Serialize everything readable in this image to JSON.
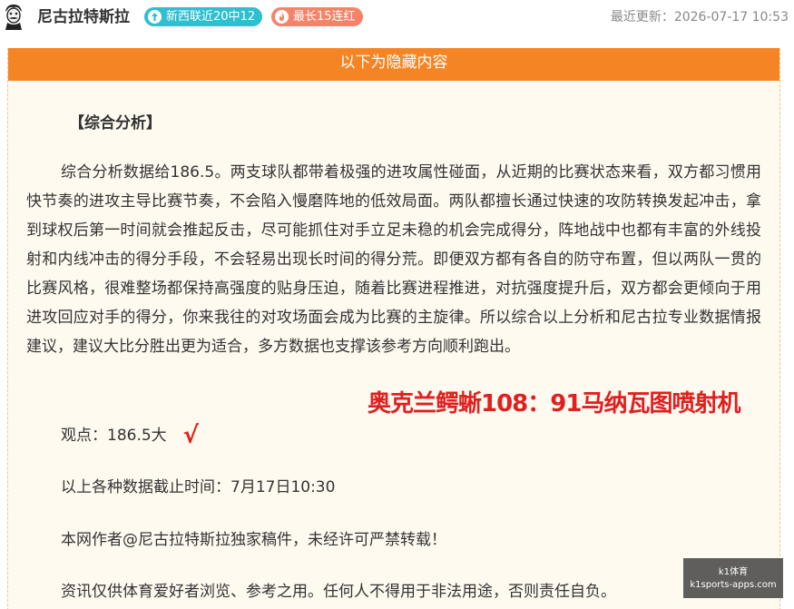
{
  "header": {
    "author": "尼古拉特斯拉",
    "badges": [
      {
        "label": "新西联近20中12",
        "icon": "arrow-up-icon",
        "color": "#2ec0cf"
      },
      {
        "label": "最长15连红",
        "icon": "flame-icon",
        "color": "#f5836a"
      }
    ],
    "updated": "最近更新：2026-07-17 10:53"
  },
  "banner": {
    "text": "以下为隐藏内容"
  },
  "article": {
    "section_title": "【综合分析】",
    "paragraph": "综合分析数据给186.5。两支球队都带着极强的进攻属性碰面，从近期的比赛状态来看，双方都习惯用快节奏的进攻主导比赛节奏，不会陷入慢磨阵地的低效局面。两队都擅长通过快速的攻防转换发起冲击，拿到球权后第一时间就会推起反击，尽可能抓住对手立足未稳的机会完成得分，阵地战中也都有丰富的外线投射和内线冲击的得分手段，不会轻易出现长时间的得分荒。即便双方都有各自的防守布置，但以两队一贯的比赛风格，很难整场都保持高强度的贴身压迫，随着比赛进程推进，对抗强度提升后，双方都会更倾向于用进攻回应对手的得分，你来我往的对攻场面会成为比赛的主旋律。所以综合以上分析和尼古拉专业数据情报建议，建议大比分胜出更为适合，多方数据也支撑该参考方向顺利跑出。",
    "viewpoint": "观点：186.5大",
    "check_mark": "√",
    "data_cutoff": "以上各种数据截止时间：7月17日10:30",
    "copyright": "本网作者@尼古拉特斯拉独家稿件，未经许可严禁转载！",
    "disclaimer": "资讯仅供体育爱好者浏览、参考之用。任何人不得用于非法用途，否则责任自负。"
  },
  "overlay_result": "奥克兰鳄蜥108：91马纳瓦图喷射机",
  "watermark": {
    "line1": "k1体育",
    "line2": "k1sports-apps.com"
  }
}
